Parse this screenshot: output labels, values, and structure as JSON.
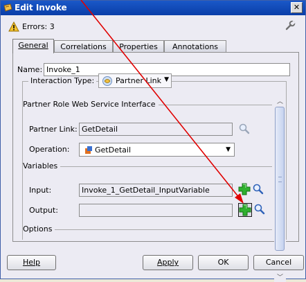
{
  "window": {
    "title": "Edit Invoke",
    "close_label": "✕"
  },
  "errors": {
    "text": "Errors: 3"
  },
  "tabs": [
    {
      "label": "General"
    },
    {
      "label": "Correlations"
    },
    {
      "label": "Properties"
    },
    {
      "label": "Annotations"
    }
  ],
  "form": {
    "name_label": "Name:",
    "name_value": "Invoke_1",
    "interaction_label": "Interaction Type:",
    "interaction_value": "Partner Link",
    "partner_role_heading": "Partner Role Web Service Interface",
    "partner_link_label": "Partner Link:",
    "partner_link_value": "GetDetail",
    "operation_label": "Operation:",
    "operation_value": "GetDetail",
    "variables_heading": "Variables",
    "input_label": "Input:",
    "input_value": "Invoke_1_GetDetail_InputVariable",
    "output_label": "Output:",
    "output_value": "",
    "options_heading": "Options"
  },
  "buttons": {
    "help": "Help",
    "apply": "Apply",
    "ok": "OK",
    "cancel": "Cancel"
  },
  "colors": {
    "title_bar": "#1a58c8",
    "annotation_arrow": "#e00000",
    "plus_icon": "#28a828"
  },
  "icons": {
    "window": "invoke-icon",
    "errors": "warning-icon",
    "settings": "wrench-icon",
    "browse": "magnifier-icon",
    "create": "green-plus-icon"
  }
}
